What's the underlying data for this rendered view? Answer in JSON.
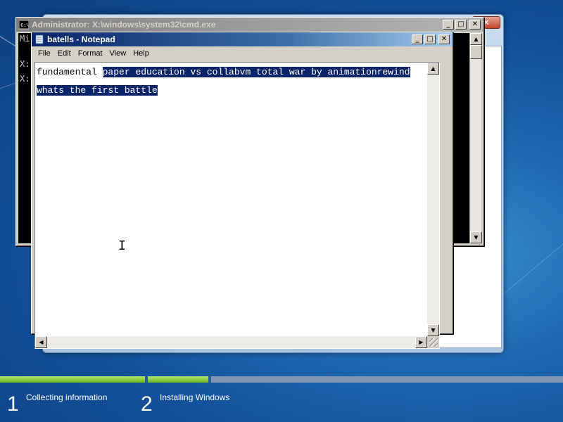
{
  "cmd_window": {
    "title": "Administrator: X:\\windows\\system32\\cmd.exe",
    "lines": [
      "Mi",
      "X:",
      "X:"
    ]
  },
  "notepad": {
    "title": "batells - Notepad",
    "menu": [
      "File",
      "Edit",
      "Format",
      "View",
      "Help"
    ],
    "text": {
      "line1_unselected": "fundamental ",
      "line1_selected": "paper education vs collabvm total war by animationrewind",
      "line2_selected": "whats the first battle"
    },
    "selection_color": "#0a246a"
  },
  "window_buttons": {
    "minimize": "_",
    "maximize": "□",
    "close": "✕"
  },
  "setup_steps": [
    {
      "number": "1",
      "label": "Collecting information"
    },
    {
      "number": "2",
      "label": "Installing Windows"
    }
  ],
  "colors": {
    "progress_green": "#69b51f",
    "desktop_blue": "#1f69b3"
  }
}
